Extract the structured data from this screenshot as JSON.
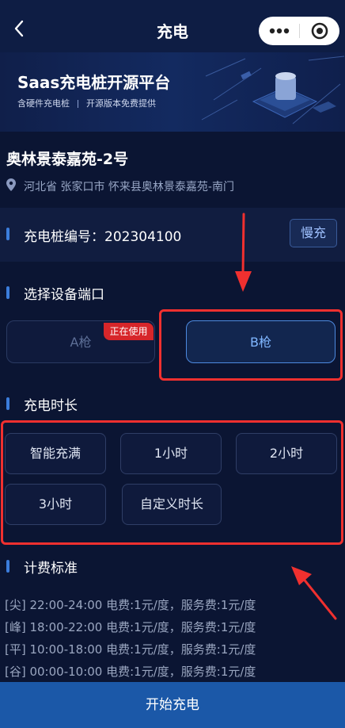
{
  "header": {
    "title": "充电",
    "back_icon": "chevron-left-icon",
    "more_icon": "more-dots-icon",
    "target_icon": "target-icon"
  },
  "banner": {
    "title": "Saas充电桩开源平台",
    "subtitle_left": "含硬件充电桩",
    "subtitle_right": "开源版本免费提供"
  },
  "station": {
    "name": "奥林景泰嘉苑-2号",
    "address": "河北省 张家口市 怀来县奥林景泰嘉苑-南门"
  },
  "charger": {
    "code_label": "充电桩编号：202304100",
    "speed_badge": "慢充"
  },
  "ports": {
    "section_title": "选择设备端口",
    "items": [
      {
        "label": "A枪",
        "status": "正在使用",
        "selected": false
      },
      {
        "label": "B枪",
        "selected": true
      }
    ]
  },
  "duration": {
    "section_title": "充电时长",
    "options": [
      "智能充满",
      "1小时",
      "2小时",
      "3小时",
      "自定义时长"
    ]
  },
  "billing": {
    "section_title": "计费标准",
    "lines": [
      "[尖] 22:00-24:00 电费:1元/度，服务费:1元/度",
      "[峰] 18:00-22:00 电费:1元/度，服务费:1元/度",
      "[平] 10:00-18:00 电费:1元/度，服务费:1元/度",
      "[谷] 00:00-10:00 电费:1元/度，服务费:1元/度"
    ]
  },
  "actions": {
    "start_label": "开始充电"
  },
  "colors": {
    "background": "#0b1533",
    "accent": "#3b7ddc",
    "primary_button": "#1b58a8",
    "in_use_badge": "#d7262a",
    "annotation": "#f0302f"
  }
}
